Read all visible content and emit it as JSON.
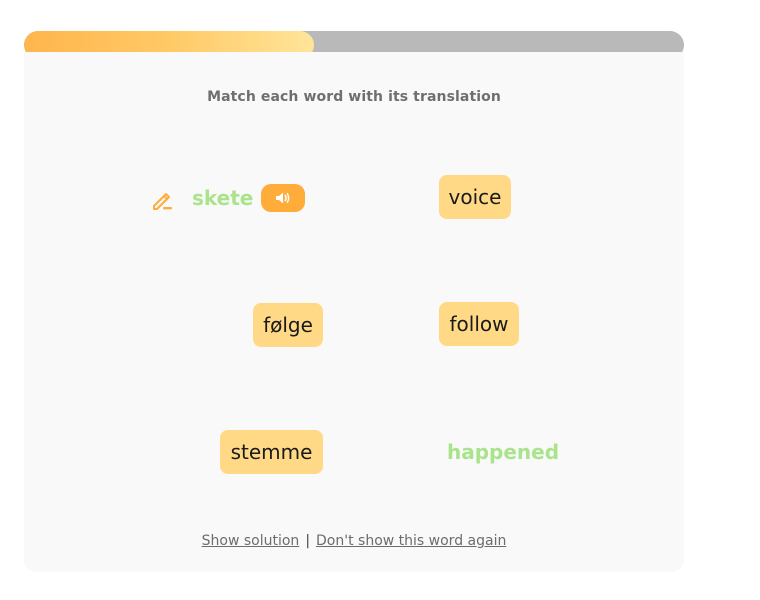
{
  "progress": {
    "fraction": 0.44
  },
  "instruction": "Match each word with its translation",
  "colors": {
    "matched_text": "#a9e48c",
    "tile_bg": "#ffd985",
    "accent": "#ffac3a",
    "progress_track": "#b9b9b9"
  },
  "icons": {
    "edit": "pencil-icon",
    "audio": "speaker-icon"
  },
  "left_column": {
    "matched": "skete",
    "tile_1": "følge",
    "tile_2": "stemme"
  },
  "right_column": {
    "tile_1": "voice",
    "tile_2": "follow",
    "matched": "happened"
  },
  "footer": {
    "show_solution": "Show solution",
    "separator": "|",
    "dont_show": "Don't show this word again"
  }
}
